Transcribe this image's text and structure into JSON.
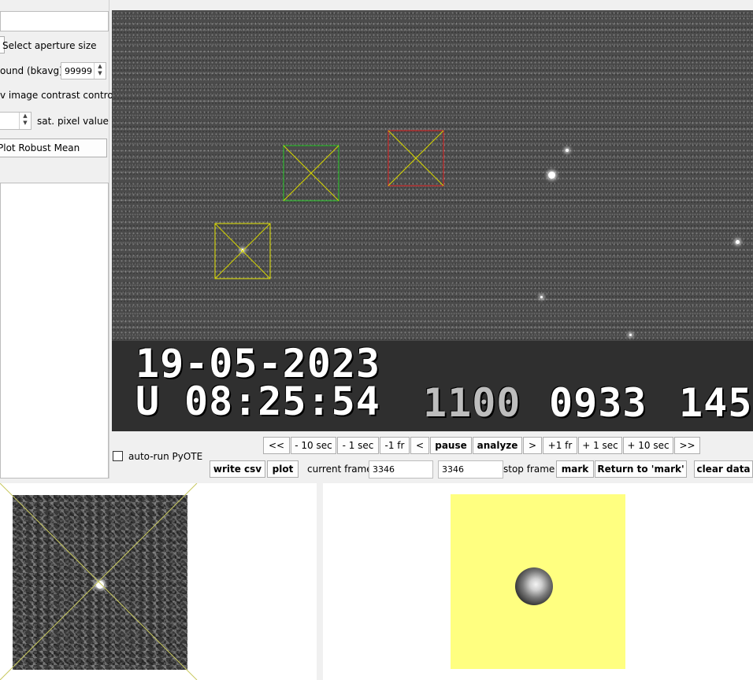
{
  "left_panel": {
    "aperture_button_label": "Select aperture size",
    "background_label": "ound (bkavg)",
    "background_value": "99999",
    "contrast_label": "v image contrast control",
    "sat_pixel_label": "sat. pixel value",
    "robust_mean_button": "Plot Robust Mean"
  },
  "osd": {
    "date": "19-05-2023",
    "time_prefix": "U",
    "time": "08:25:54",
    "field1": "1100",
    "field2": "0933",
    "field3": "145"
  },
  "nav_buttons": [
    "<<",
    "- 10 sec",
    "- 1 sec",
    "-1 fr",
    "<",
    "pause",
    "analyze",
    ">",
    "+1 fr",
    "+ 1 sec",
    "+ 10 sec",
    ">>"
  ],
  "controls": {
    "auto_run_label": "auto-run PyOTE",
    "write_csv": "write csv",
    "plot": "plot",
    "current_frame_label": "current frame",
    "current_frame_value": "3346",
    "stop_frame_value": "3346",
    "stop_frame_label": "stop frame",
    "mark": "mark",
    "return_to_mark": "Return to 'mark'",
    "clear_data": "clear data"
  },
  "colors": {
    "aperture_green": "#22c422",
    "aperture_red": "#e02020",
    "aperture_yellow": "#e6e600",
    "thumb_background": "#ffff80"
  }
}
